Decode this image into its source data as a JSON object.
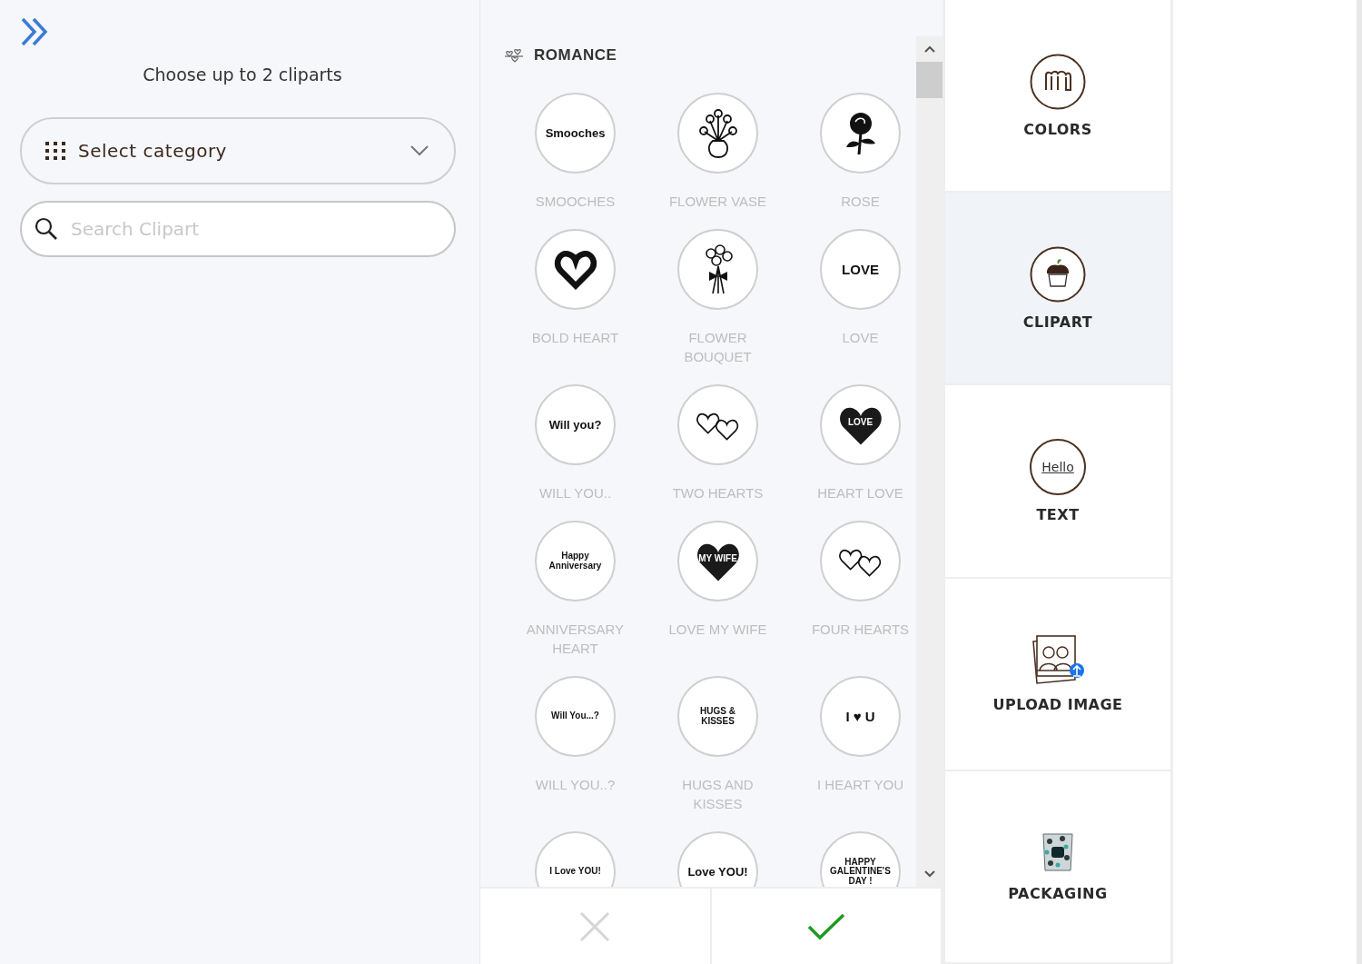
{
  "sidebar": {
    "prompt": "Choose up to 2 cliparts",
    "category_select": {
      "placeholder": "Select category"
    },
    "search": {
      "placeholder": "Search Clipart"
    }
  },
  "clipart_list": {
    "category": "ROMANCE",
    "items": [
      {
        "label": "SMOOCHES",
        "kind": "text",
        "art_text": "Smooches"
      },
      {
        "label": "FLOWER VASE",
        "kind": "vase"
      },
      {
        "label": "ROSE",
        "kind": "rose"
      },
      {
        "label": "BOLD HEART",
        "kind": "heart"
      },
      {
        "label": "FLOWER BOUQUET",
        "kind": "bouquet"
      },
      {
        "label": "LOVE",
        "kind": "text",
        "art_text": "LOVE"
      },
      {
        "label": "WILL YOU..",
        "kind": "text",
        "art_text": "Will you?"
      },
      {
        "label": "TWO HEARTS",
        "kind": "hearts"
      },
      {
        "label": "HEART LOVE",
        "kind": "heart_text",
        "art_text": "LOVE"
      },
      {
        "label": "ANNIVERSARY HEART",
        "kind": "text",
        "art_text": "Happy Anniversary"
      },
      {
        "label": "LOVE MY WIFE",
        "kind": "heart_text",
        "art_text": "MY WIFE"
      },
      {
        "label": "FOUR HEARTS",
        "kind": "hearts"
      },
      {
        "label": "WILL YOU..?",
        "kind": "text",
        "art_text": "Will You...?"
      },
      {
        "label": "HUGS AND KISSES",
        "kind": "text",
        "art_text": "HUGS & KISSES"
      },
      {
        "label": "I HEART YOU",
        "kind": "text",
        "art_text": "I ♥ U"
      },
      {
        "kind": "text",
        "art_text": "I Love YOU!"
      },
      {
        "kind": "text",
        "art_text": "Love YOU!"
      },
      {
        "kind": "text",
        "art_text": "HAPPY GALENTINE'S DAY !"
      }
    ]
  },
  "actions": [
    {
      "kind": "cancel",
      "disabled": true
    },
    {
      "kind": "confirm",
      "disabled": false
    }
  ],
  "nav": {
    "items": [
      {
        "label": "COLORS",
        "kind": "colors",
        "selected": false
      },
      {
        "label": "CLIPART",
        "kind": "clipart",
        "selected": true
      },
      {
        "label": "TEXT",
        "kind": "text",
        "icon_text": "Hello",
        "selected": false
      },
      {
        "label": "UPLOAD IMAGE",
        "kind": "upload",
        "selected": false
      },
      {
        "label": "PACKAGING",
        "kind": "packaging",
        "selected": false
      }
    ]
  }
}
